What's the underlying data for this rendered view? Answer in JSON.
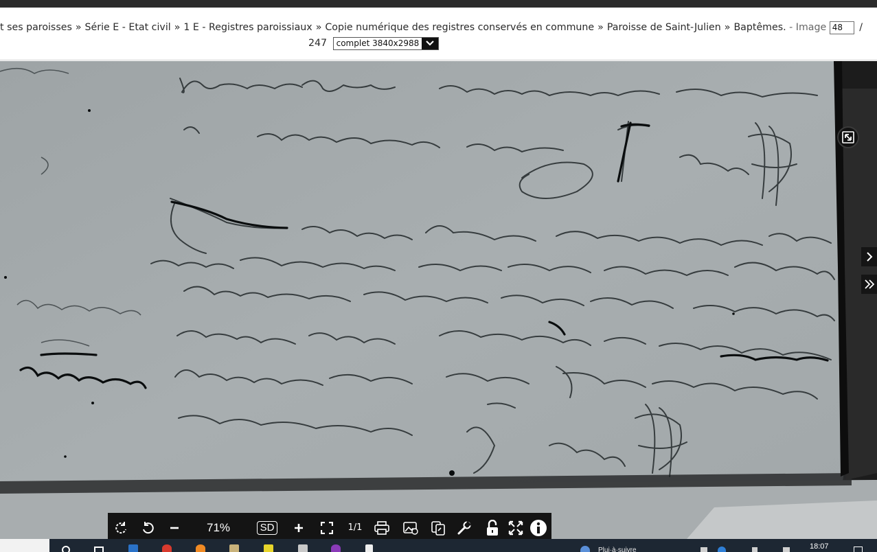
{
  "breadcrumb": {
    "items": [
      "t ses paroisses",
      "Série E - Etat civil",
      "1 E - Registres paroissiaux",
      "Copie numérique des registres conservés en commune",
      "Paroisse de Saint-Julien",
      "Baptêmes."
    ],
    "separator": "»",
    "image_label": "- Image",
    "image_current": "48",
    "image_slash": "/",
    "image_total": "247",
    "resolution_option": "complet 3840x2988"
  },
  "toolbar": {
    "zoom_value": "71%",
    "quality_label": "SD",
    "ratio_label": "1/1"
  },
  "taskbar": {
    "clock": "18:07",
    "tray_text": "Plui·à·suivre"
  },
  "colors": {
    "toolbar_bg": "#141414",
    "header_bg": "#ffffff",
    "scan_paper": "#a3a9ab",
    "ink": "#141a1c"
  }
}
